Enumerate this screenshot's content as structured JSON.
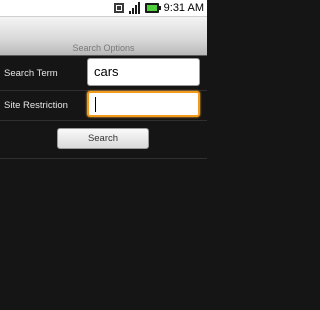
{
  "status_bar": {
    "time": "9:31 AM",
    "icons": [
      "sim-card-icon",
      "signal-strength-icon",
      "battery-icon"
    ]
  },
  "title_bar": {
    "title": "Search Options"
  },
  "form": {
    "search_term": {
      "label": "Search Term",
      "value": "cars"
    },
    "site_restriction": {
      "label": "Site Restriction",
      "value": ""
    },
    "search_button_label": "Search"
  },
  "colors": {
    "background": "#151515",
    "focus_outline": "#f29a1c"
  }
}
